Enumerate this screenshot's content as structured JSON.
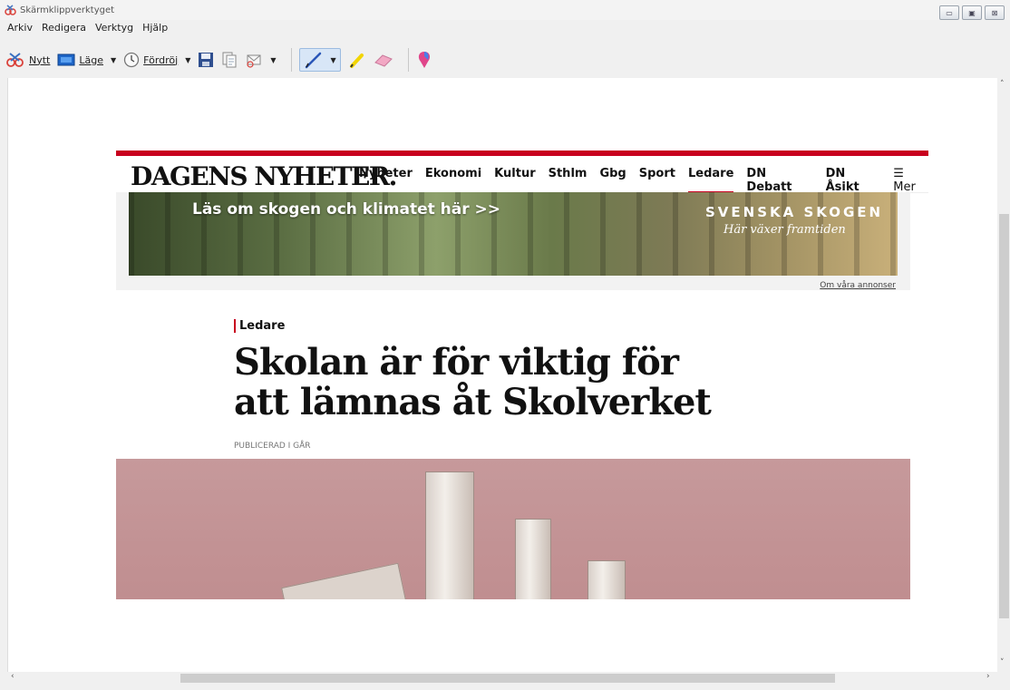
{
  "window": {
    "title": "Skärmklippverktyget",
    "colors": {
      "accent_red": "#c8001e",
      "hero_pink": "#c3989a"
    }
  },
  "menubar": [
    "Arkiv",
    "Redigera",
    "Verktyg",
    "Hjälp"
  ],
  "toolbar": {
    "new_label": "Nytt",
    "mode_label": "Läge",
    "delay_label": "Fördröj",
    "icons": [
      "scissors-icon",
      "mode-icon",
      "clock-icon",
      "save-icon",
      "copy-icon",
      "send-icon",
      "pen-icon",
      "highlighter-icon",
      "eraser-icon",
      "paint3d-icon"
    ]
  },
  "page": {
    "logo": "DAGENS NYHETER.",
    "nav": [
      "Nyheter",
      "Ekonomi",
      "Kultur",
      "Sthlm",
      "Gbg",
      "Sport",
      "Ledare",
      "DN Debatt",
      "DN Åsikt"
    ],
    "nav_active": "Ledare",
    "nav_more": "Mer",
    "ad": {
      "left_text": "Läs om skogen och klimatet här >>",
      "brand": "SVENSKA SKOGEN",
      "tagline": "Här växer framtiden",
      "link": "Om våra annonser"
    },
    "article": {
      "category": "Ledare",
      "headline": "Skolan är för viktig för att lämnas åt Skolverket",
      "published": "PUBLICERAD I GÅR"
    }
  }
}
